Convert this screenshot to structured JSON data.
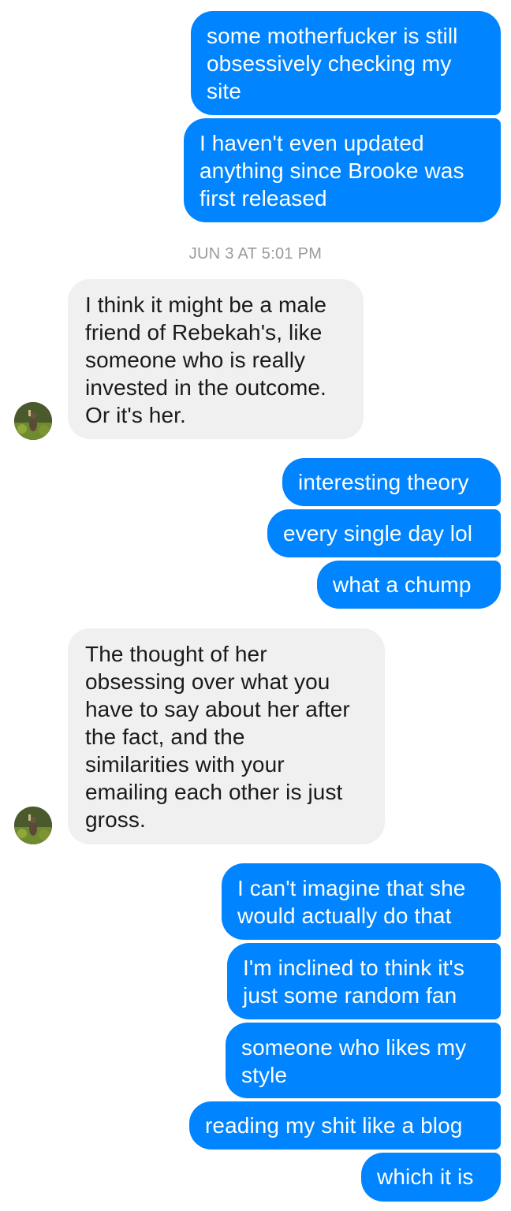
{
  "conversation": {
    "timestamp": "JUN 3 AT 5:01 PM",
    "messages": [
      {
        "from": "me",
        "text": "some motherfucker is still\nobsessively checking my\nsite"
      },
      {
        "from": "me",
        "text": "I haven't even updated\nanything since Brooke was\nfirst released"
      },
      {
        "from": "them",
        "text": "I think it might be a male\nfriend of Rebekah's, like\nsomeone who is really\ninvested in the outcome.\nOr it's her."
      },
      {
        "from": "me",
        "text": "interesting theory"
      },
      {
        "from": "me",
        "text": "every single day lol"
      },
      {
        "from": "me",
        "text": "what a chump"
      },
      {
        "from": "them",
        "text": "The thought of her\nobsessing over what you\nhave to say about her after\nthe fact, and the\nsimilarities with your\nemailing each other is just\ngross."
      },
      {
        "from": "me",
        "text": "I can't imagine that she\nwould actually do that"
      },
      {
        "from": "me",
        "text": "I'm inclined to think it's\njust some random fan"
      },
      {
        "from": "me",
        "text": "someone who likes my\nstyle"
      },
      {
        "from": "me",
        "text": "reading my shit like a blog"
      },
      {
        "from": "me",
        "text": "which it is"
      }
    ]
  },
  "colors": {
    "sent_bubble": "#0084ff",
    "received_bubble": "#f1f0f0",
    "timestamp_text": "#9a9a9a"
  },
  "icons": {
    "contact_avatar": "avatar-photo-icon"
  }
}
